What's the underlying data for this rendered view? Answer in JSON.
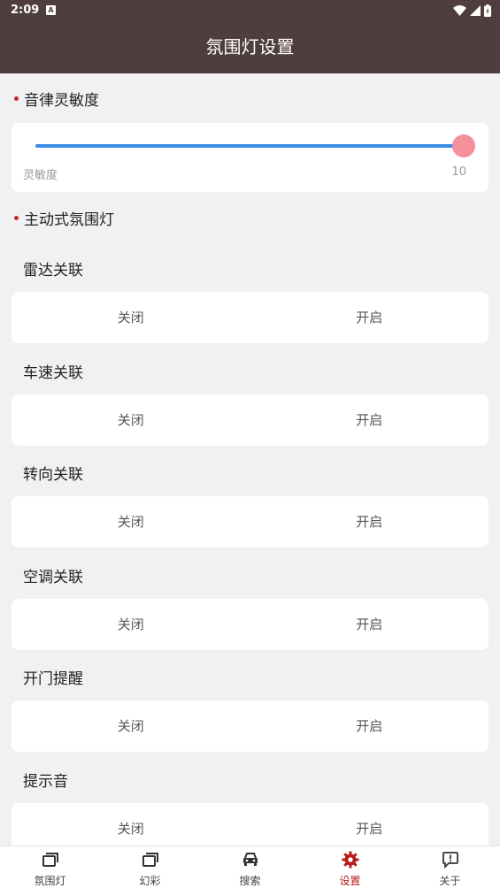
{
  "status": {
    "time": "2:09",
    "notif_glyph": "A"
  },
  "header": {
    "title": "氛围灯设置"
  },
  "sensitivity": {
    "section_title": "音律灵敏度",
    "label": "灵敏度",
    "value": "10",
    "level_fraction": 1.0
  },
  "active_section": {
    "title": "主动式氛围灯"
  },
  "settings": [
    {
      "title": "雷达关联",
      "off_label": "关闭",
      "on_label": "开启"
    },
    {
      "title": "车速关联",
      "off_label": "关闭",
      "on_label": "开启"
    },
    {
      "title": "转向关联",
      "off_label": "关闭",
      "on_label": "开启"
    },
    {
      "title": "空调关联",
      "off_label": "关闭",
      "on_label": "开启"
    },
    {
      "title": "开门提醒",
      "off_label": "关闭",
      "on_label": "开启"
    },
    {
      "title": "提示音",
      "off_label": "关闭",
      "on_label": "开启"
    }
  ],
  "tabs": [
    {
      "label": "氛围灯",
      "icon": "window-stack-icon",
      "active": false
    },
    {
      "label": "幻彩",
      "icon": "window-stack-icon",
      "active": false
    },
    {
      "label": "搜索",
      "icon": "car-icon",
      "active": false
    },
    {
      "label": "设置",
      "icon": "gear-icon",
      "active": true
    },
    {
      "label": "关于",
      "icon": "alert-message-icon",
      "active": false
    }
  ],
  "colors": {
    "header_bg": "#4e3e3d",
    "accent": "#b71c1c",
    "slider_track": "#3a8ee6",
    "slider_thumb": "#f48f9c"
  }
}
